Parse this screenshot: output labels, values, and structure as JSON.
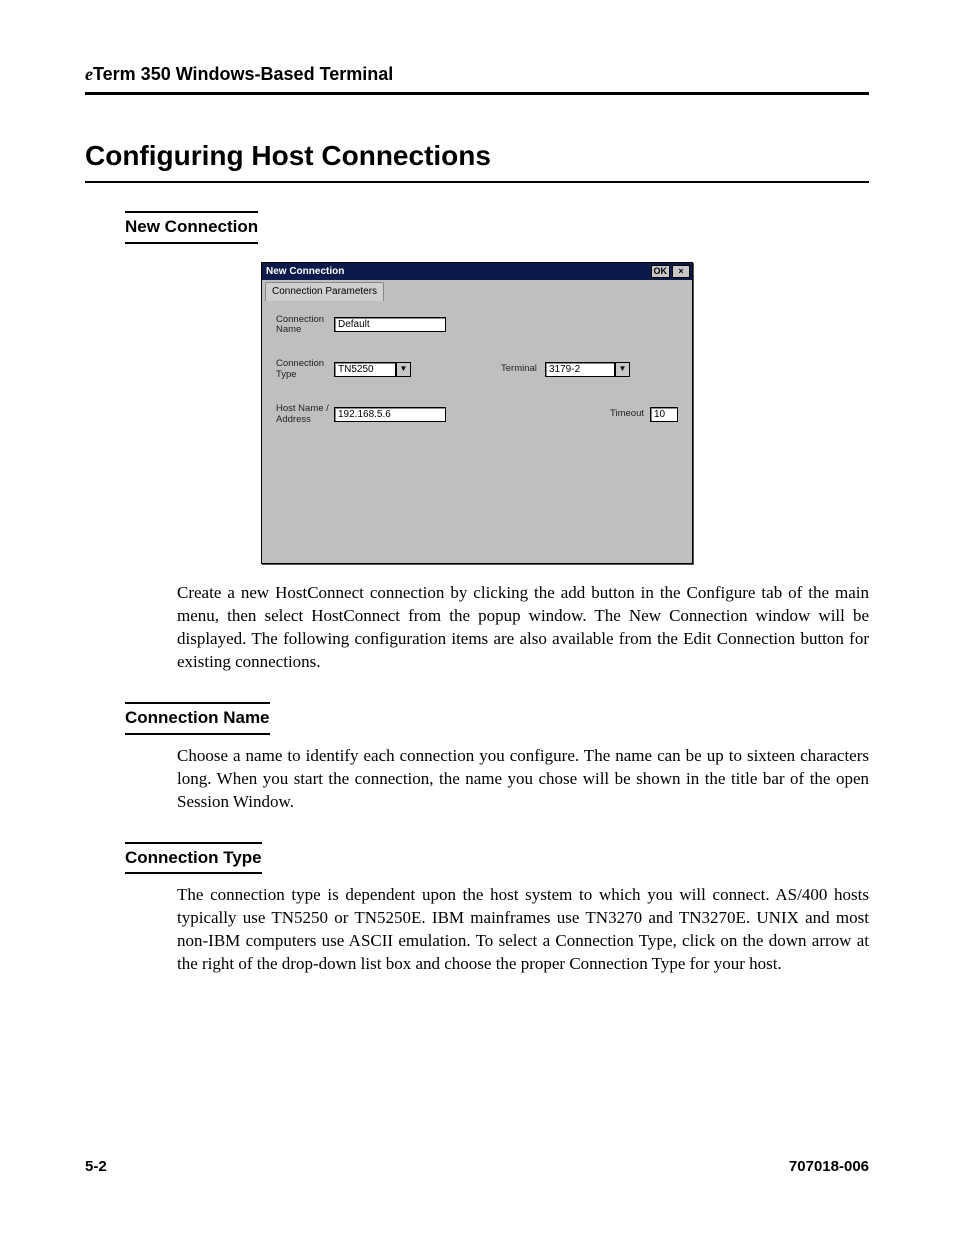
{
  "header": {
    "prefix_italic": "e",
    "title_rest": "Term 350 Windows-Based Terminal"
  },
  "page_title": "Configuring Host Connections",
  "sections": {
    "new_connection": {
      "heading": "New Connection",
      "body": "Create a new HostConnect connection by clicking the add button in the Configure tab of the main menu, then select HostConnect from the popup window. The New Connection window will be displayed. The following configuration items are also available from the Edit Connection button for existing connections."
    },
    "connection_name": {
      "heading": "Connection Name",
      "body": "Choose a name to identify each connection you configure. The name can be up to sixteen characters long. When you start the connection, the name you chose will be shown in the title bar of the open Session Window."
    },
    "connection_type": {
      "heading": "Connection Type",
      "body": "The connection type is dependent upon the host system to which you will connect. AS/400 hosts typically use TN5250 or TN5250E. IBM mainframes use TN3270 and TN3270E. UNIX and most non-IBM computers use ASCII emulation. To select a Connection Type, click on the down arrow at the right of the drop-down list box and choose the proper Connection Type for your host."
    }
  },
  "dialog": {
    "title": "New Connection",
    "ok_label": "OK",
    "close_glyph": "×",
    "tab_label": "Connection Parameters",
    "fields": {
      "connection_name": {
        "label": "Connection Name",
        "value": "Default"
      },
      "connection_type": {
        "label": "Connection Type",
        "value": "TN5250"
      },
      "terminal": {
        "label": "Terminal",
        "value": "3179-2"
      },
      "host": {
        "label": "Host Name / Address",
        "value": "192.168.5.6"
      },
      "timeout": {
        "label": "Timeout",
        "value": "10"
      }
    },
    "dropdown_glyph": "▼"
  },
  "footer": {
    "page_num": "5-2",
    "doc_num": "707018-006"
  }
}
